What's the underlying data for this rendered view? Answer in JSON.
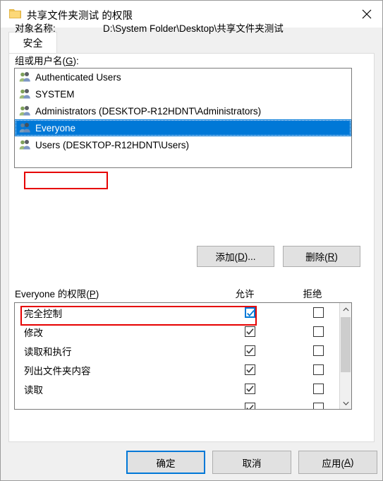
{
  "window": {
    "title": "共享文件夹测试 的权限",
    "folder_icon": "folder-icon",
    "close_icon": "close-icon"
  },
  "tabs": [
    {
      "label": "安全",
      "selected": true
    }
  ],
  "object": {
    "label": "对象名称:",
    "value": "D:\\System Folder\\Desktop\\共享文件夹测试"
  },
  "groups": {
    "label_prefix": "组或用户名(",
    "label_accel": "G",
    "label_suffix": "):",
    "items": [
      {
        "name": "Authenticated Users",
        "selected": false
      },
      {
        "name": "SYSTEM",
        "selected": false
      },
      {
        "name": "Administrators (DESKTOP-R12HDNT\\Administrators)",
        "selected": false
      },
      {
        "name": "Everyone",
        "selected": true
      },
      {
        "name": "Users (DESKTOP-R12HDNT\\Users)",
        "selected": false
      }
    ],
    "add_button": {
      "prefix": "添加(",
      "accel": "D",
      "suffix": ")..."
    },
    "remove_button": {
      "prefix": "删除(",
      "accel": "R",
      "suffix": ")"
    }
  },
  "permissions": {
    "label_prefix": "Everyone 的权限(",
    "label_accel": "P",
    "label_suffix": ")",
    "column_allow": "允许",
    "column_deny": "拒绝",
    "rows": [
      {
        "name": "完全控制",
        "allow": true,
        "deny": false,
        "focused": true
      },
      {
        "name": "修改",
        "allow": true,
        "deny": false,
        "focused": false
      },
      {
        "name": "读取和执行",
        "allow": true,
        "deny": false,
        "focused": false
      },
      {
        "name": "列出文件夹内容",
        "allow": true,
        "deny": false,
        "focused": false
      },
      {
        "name": "读取",
        "allow": true,
        "deny": false,
        "focused": false
      },
      {
        "name": "",
        "allow": true,
        "deny": false,
        "focused": false
      }
    ],
    "scrollbar": {
      "up_icon": "chevron-up-icon",
      "down_icon": "chevron-down-icon"
    }
  },
  "footer": {
    "ok": "确定",
    "cancel": "取消",
    "apply": {
      "prefix": "应用(",
      "accel": "A",
      "suffix": ")"
    }
  },
  "colors": {
    "accent": "#0078d7",
    "annotation": "#e60000",
    "selection": "#0078d7",
    "button_face": "#e1e1e1"
  },
  "annotations": [
    {
      "target": "group-item-everyone"
    },
    {
      "target": "permission-row-full-control"
    }
  ]
}
